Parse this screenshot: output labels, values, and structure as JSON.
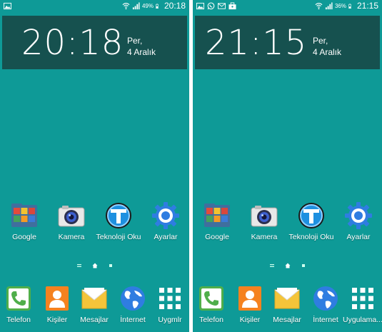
{
  "screens": [
    {
      "status": {
        "battery_pct": "49%",
        "time": "20:18"
      },
      "clock": {
        "time": "20:18",
        "day": "Per,",
        "date": "4 Aralık"
      },
      "apps": [
        "Google",
        "Kamera",
        "Teknoloji Oku",
        "Ayarlar"
      ],
      "dock": [
        "Telefon",
        "Kişiler",
        "Mesajlar",
        "İnternet",
        "Uygmlr"
      ]
    },
    {
      "status": {
        "battery_pct": "36%",
        "time": "21:15"
      },
      "clock": {
        "time": "21:15",
        "day": "Per,",
        "date": "4 Aralık"
      },
      "apps": [
        "Google",
        "Kamera",
        "Teknoloji Oku",
        "Ayarlar"
      ],
      "dock": [
        "Telefon",
        "Kişiler",
        "Mesajlar",
        "İnternet",
        "Uygulama..."
      ]
    }
  ],
  "colors": {
    "wallpaper": "#0e9a97",
    "clock_widget": "#16514f",
    "text": "#ffffff"
  },
  "icons": {
    "status_left_screen1": [
      "image-notification-icon"
    ],
    "status_left_screen2": [
      "image-notification-icon",
      "whatsapp-notification-icon",
      "mail-notification-icon",
      "briefcase-notification-icon"
    ],
    "status_right": [
      "wifi-icon",
      "signal-icon",
      "battery-icon"
    ],
    "apps": [
      "google-folder-icon",
      "camera-icon",
      "teknoloji-oku-icon",
      "settings-gear-icon"
    ],
    "dock": [
      "phone-icon",
      "contacts-icon",
      "messages-icon",
      "internet-globe-icon",
      "apps-grid-icon"
    ],
    "page_indicator": [
      "menu-lines-icon",
      "home-icon",
      "page-dot-icon"
    ]
  }
}
